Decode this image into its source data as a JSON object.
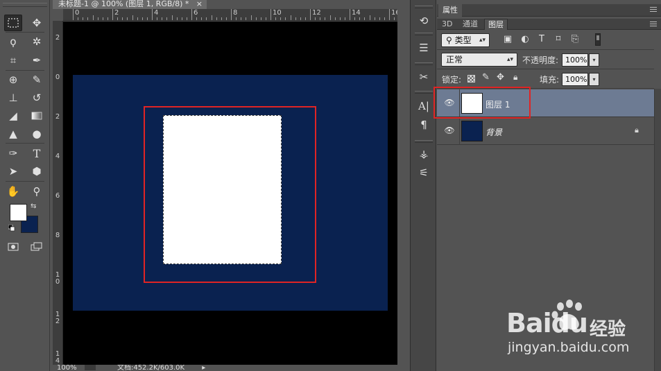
{
  "document": {
    "tab_title": "未标题-1 @ 100% (图层 1, RGB/8) *",
    "close_glyph": "×",
    "status_zoom": "100%",
    "status_doc": "文档:452.2K/603.0K"
  },
  "rulers": {
    "top_labels": [
      "0",
      "2",
      "4",
      "6",
      "8",
      "10",
      "12",
      "14",
      "16"
    ],
    "left_labels": [
      "2",
      "0",
      "2",
      "4",
      "6",
      "8",
      "1\n0",
      "1\n2",
      "1\n4"
    ]
  },
  "colors": {
    "foreground": "#ffffff",
    "background": "#0a2250",
    "canvas_black": "#000000",
    "navy_layer": "#0a2250",
    "highlight_red": "#e02424",
    "selected_row": "#6d7b93"
  },
  "properties_panel": {
    "tab_label": "属性"
  },
  "layers_panel": {
    "tabs": [
      "3D",
      "通道",
      "图层"
    ],
    "active_tab": "图层",
    "filter_type": "类型",
    "blend_mode": "正常",
    "opacity_label": "不透明度:",
    "opacity_value": "100%",
    "lock_label": "锁定:",
    "fill_label": "填充:",
    "fill_value": "100%",
    "layers": [
      {
        "name": "图层 1",
        "selected": true,
        "visible": true,
        "locked": false,
        "thumb_color": "#ffffff"
      },
      {
        "name": "背景",
        "selected": false,
        "visible": true,
        "locked": true,
        "thumb_color": "#0a2250"
      }
    ]
  },
  "watermark": {
    "brand": "Baidu",
    "brand_cn": "经验",
    "url": "jingyan.baidu.com"
  }
}
